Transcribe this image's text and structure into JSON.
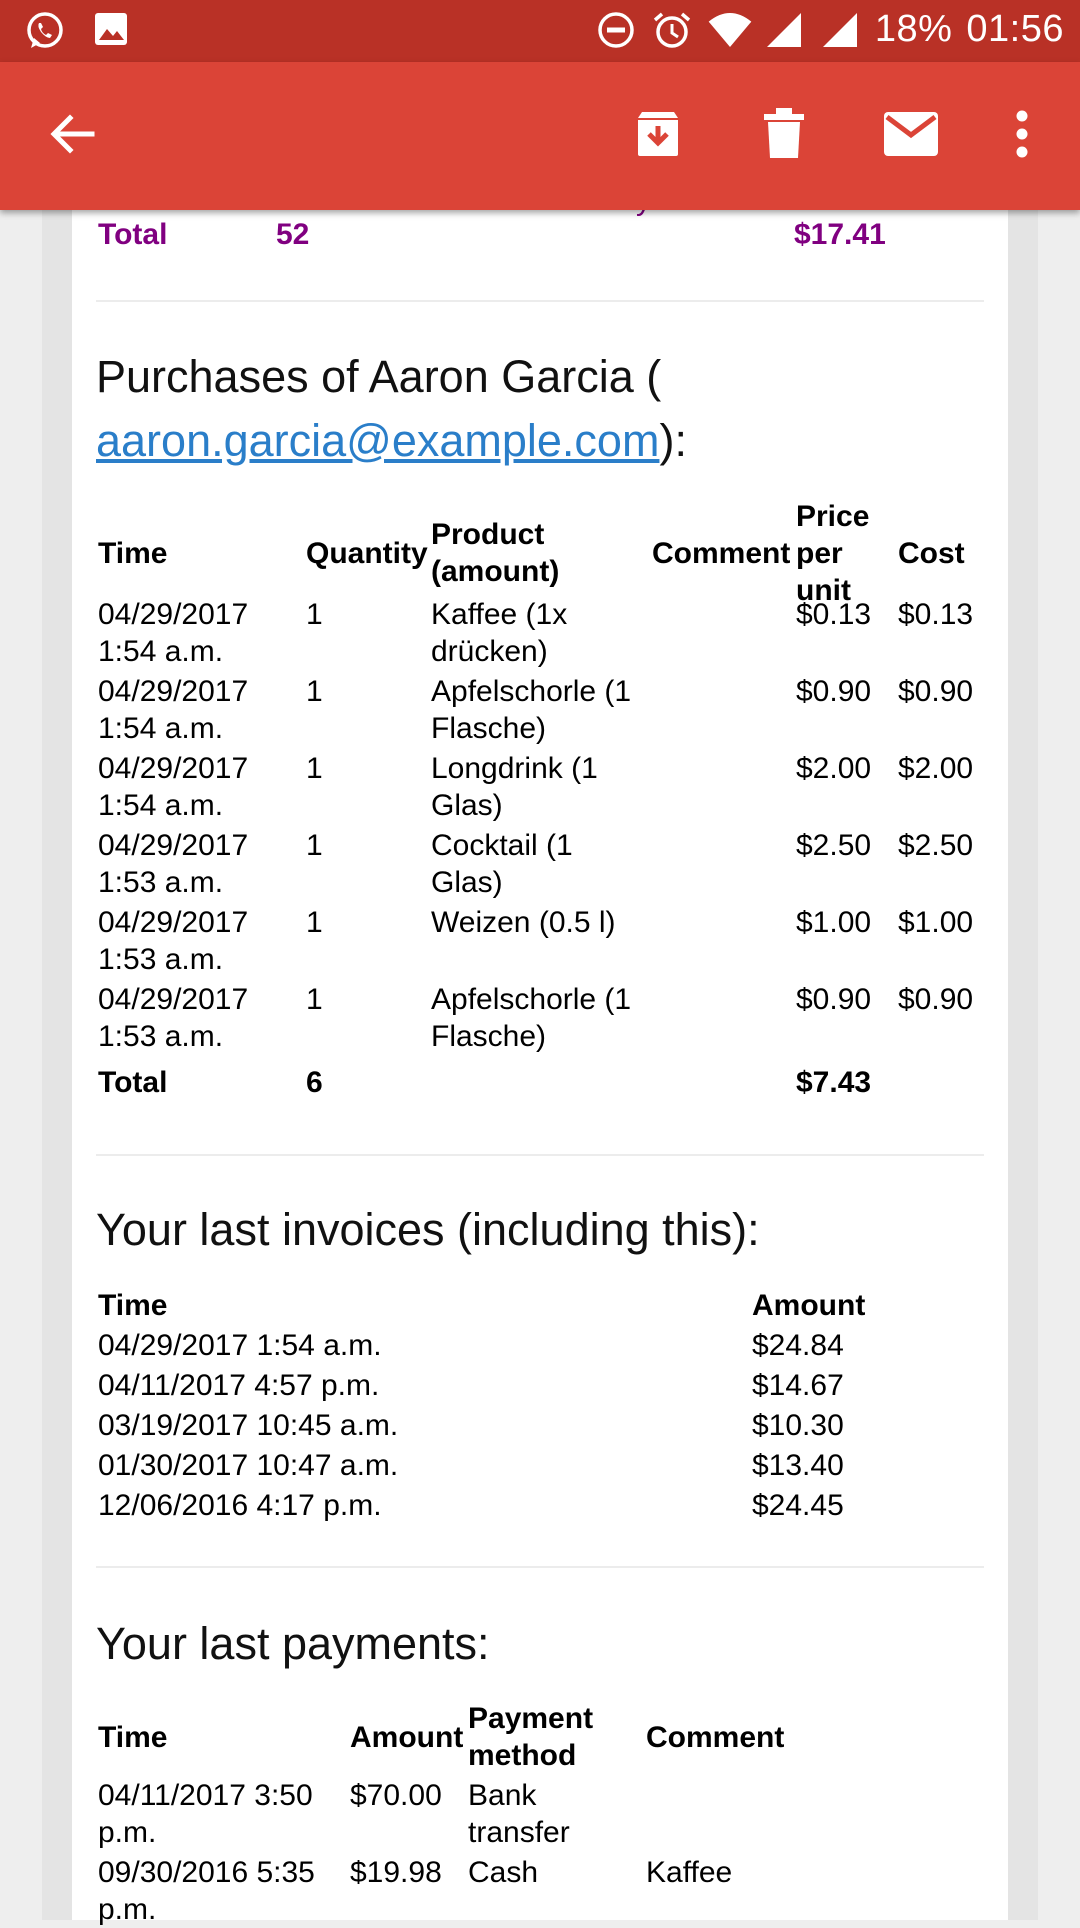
{
  "status_bar": {
    "battery": "18%",
    "time": "01:56",
    "icons": [
      "whatsapp-icon",
      "image-icon",
      "do-not-disturb-icon",
      "alarm-icon",
      "wifi-icon",
      "signal-icon",
      "signal-icon"
    ]
  },
  "app_bar": {
    "icons": [
      "back-arrow-icon",
      "archive-icon",
      "delete-icon",
      "mail-icon",
      "more-vert-icon"
    ]
  },
  "top_total": {
    "label": "Total",
    "quantity": "52",
    "cost": "$17.41"
  },
  "purchases": {
    "heading_prefix": "Purchases of Aaron Garcia (",
    "email": "aaron.garcia@example.com",
    "heading_suffix": "):",
    "columns": {
      "time": "Time",
      "quantity": "Quantity",
      "product_l1": "Product",
      "product_l2": "(amount)",
      "comment": "Comment",
      "price_l1": "Price",
      "price_l2": "per",
      "price_l3": "unit",
      "cost": "Cost"
    },
    "rows": [
      {
        "date": "04/29/2017",
        "time": "1:54 a.m.",
        "quantity": "1",
        "product_l1": "Kaffee (1x",
        "product_l2": "drücken)",
        "price": "$0.13",
        "cost": "$0.13"
      },
      {
        "date": "04/29/2017",
        "time": "1:54 a.m.",
        "quantity": "1",
        "product_l1": "Apfelschorle (1",
        "product_l2": "Flasche)",
        "price": "$0.90",
        "cost": "$0.90"
      },
      {
        "date": "04/29/2017",
        "time": "1:54 a.m.",
        "quantity": "1",
        "product_l1": "Longdrink (1",
        "product_l2": "Glas)",
        "price": "$2.00",
        "cost": "$2.00"
      },
      {
        "date": "04/29/2017",
        "time": "1:53 a.m.",
        "quantity": "1",
        "product_l1": "Cocktail (1",
        "product_l2": "Glas)",
        "price": "$2.50",
        "cost": "$2.50"
      },
      {
        "date": "04/29/2017",
        "time": "1:53 a.m.",
        "quantity": "1",
        "product_l1": "Weizen (0.5 l)",
        "product_l2": "",
        "price": "$1.00",
        "cost": "$1.00"
      },
      {
        "date": "04/29/2017",
        "time": "1:53 a.m.",
        "quantity": "1",
        "product_l1": "Apfelschorle (1",
        "product_l2": "Flasche)",
        "price": "$0.90",
        "cost": "$0.90"
      }
    ],
    "total": {
      "label": "Total",
      "quantity": "6",
      "amount": "$7.43"
    }
  },
  "invoices": {
    "heading": "Your last invoices (including this):",
    "columns": {
      "time": "Time",
      "amount": "Amount"
    },
    "rows": [
      {
        "time": "04/29/2017 1:54 a.m.",
        "amount": "$24.84"
      },
      {
        "time": "04/11/2017 4:57 p.m.",
        "amount": "$14.67"
      },
      {
        "time": "03/19/2017 10:45 a.m.",
        "amount": "$10.30"
      },
      {
        "time": "01/30/2017 10:47 a.m.",
        "amount": "$13.40"
      },
      {
        "time": "12/06/2016 4:17 p.m.",
        "amount": "$24.45"
      }
    ]
  },
  "payments": {
    "heading": "Your last payments:",
    "columns": {
      "time": "Time",
      "amount": "Amount",
      "method_l1": "Payment",
      "method_l2": "method",
      "comment": "Comment"
    },
    "rows": [
      {
        "time_l1": "04/11/2017 3:50",
        "time_l2": "p.m.",
        "amount": "$70.00",
        "method_l1": "Bank",
        "method_l2": "transfer",
        "comment": ""
      },
      {
        "time_l1": "09/30/2016 5:35",
        "time_l2": "p.m.",
        "amount": "$19.98",
        "method_l1": "Cash",
        "method_l2": "",
        "comment": "Kaffee"
      }
    ]
  },
  "colors": {
    "status_bar": "#b93126",
    "app_bar": "#db4437",
    "total_purple": "#800080",
    "link": "#2a7ec9"
  }
}
